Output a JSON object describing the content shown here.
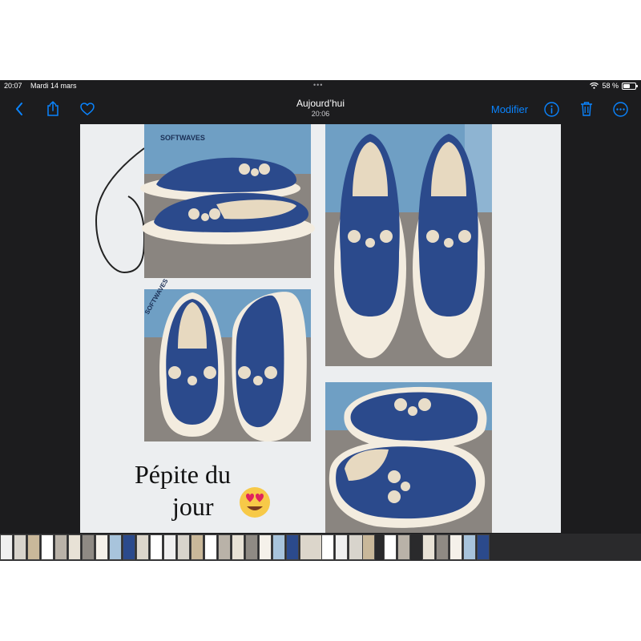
{
  "status_bar": {
    "time": "20:07",
    "date": "Mardi 14 mars",
    "battery": "58 %",
    "battery_level": 0.58
  },
  "nav": {
    "title": "Aujourd’hui",
    "subtitle": "20:06",
    "edit_label": "Modifier",
    "icons": [
      "back-icon",
      "share-icon",
      "heart-icon",
      "info-icon",
      "trash-icon",
      "more-icon"
    ]
  },
  "photo": {
    "brand_tag_1": "SOFTWAVES",
    "brand_tag_2": "SOFTWAVES",
    "caption_line_1": "Pépite du",
    "caption_line_2": "jour",
    "caption_emoji": "😍"
  },
  "thumbnails": {
    "count": 34
  },
  "colors": {
    "accent": "#0a84ff",
    "background": "#1c1c1e",
    "shoe_blue": "#2b4a8c",
    "sole": "#f3ecdf",
    "carpet": "#8a8580",
    "box_blue": "#6f9fc4"
  }
}
